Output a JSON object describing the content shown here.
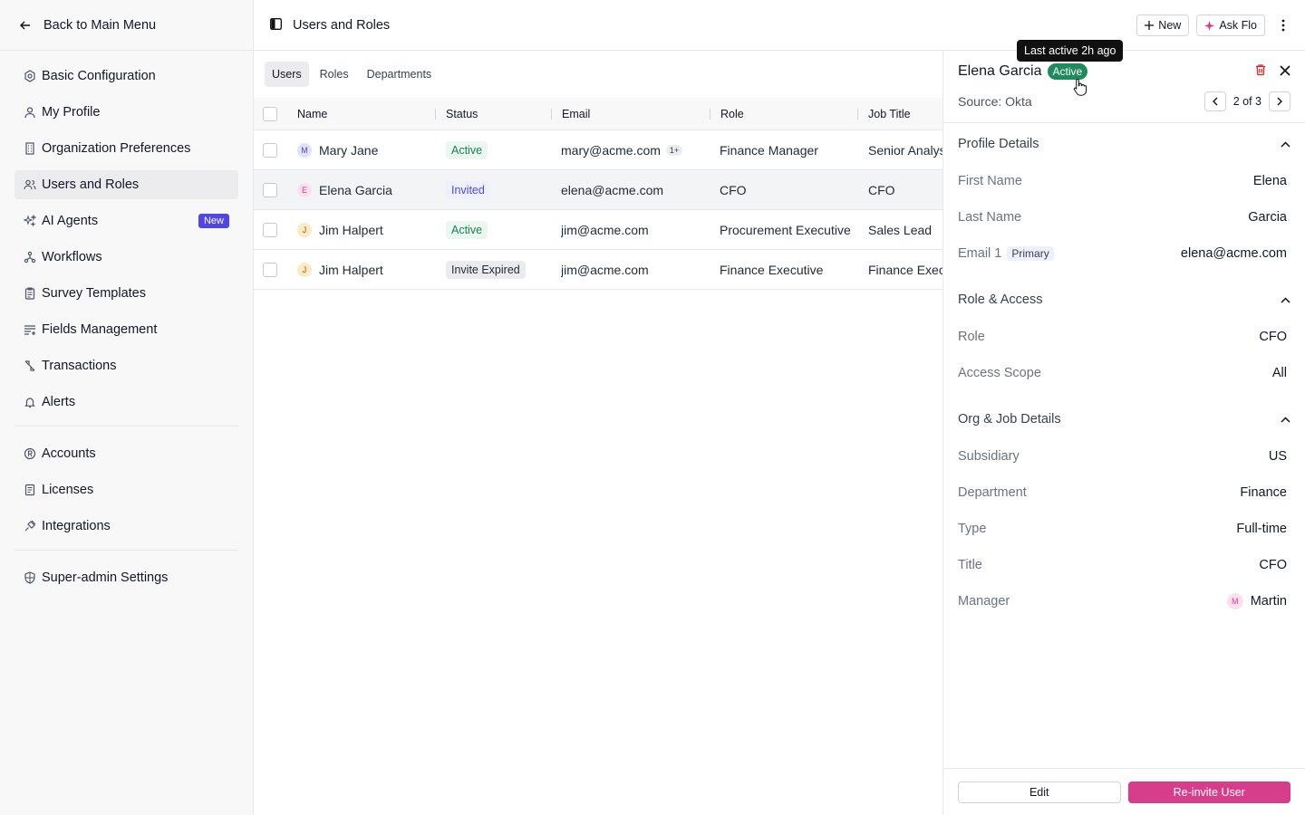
{
  "sidebar": {
    "back_label": "Back to Main Menu",
    "items": [
      {
        "label": "Basic Configuration",
        "icon": "gear-icon"
      },
      {
        "label": "My Profile",
        "icon": "user-icon"
      },
      {
        "label": "Organization Preferences",
        "icon": "building-icon"
      },
      {
        "label": "Users and Roles",
        "icon": "users-icon",
        "active": true
      },
      {
        "label": "AI Agents",
        "icon": "sparkle-icon",
        "badge": "New"
      },
      {
        "label": "Workflows",
        "icon": "workflow-icon"
      },
      {
        "label": "Survey Templates",
        "icon": "clipboard-icon"
      },
      {
        "label": "Fields Management",
        "icon": "list-icon"
      },
      {
        "label": "Transactions",
        "icon": "transaction-icon"
      },
      {
        "label": "Alerts",
        "icon": "bell-icon"
      },
      {
        "label": "Accounts",
        "icon": "accounts-icon"
      },
      {
        "label": "Licenses",
        "icon": "license-icon"
      },
      {
        "label": "Integrations",
        "icon": "plug-icon"
      },
      {
        "label": "Super-admin Settings",
        "icon": "shield-icon"
      }
    ]
  },
  "header": {
    "title": "Users and Roles",
    "new_label": "New",
    "ask_label": "Ask Flo"
  },
  "tabs": [
    "Users",
    "Roles",
    "Departments"
  ],
  "table": {
    "columns": [
      "Name",
      "Status",
      "Email",
      "Role",
      "Job Title"
    ],
    "rows": [
      {
        "initial": "M",
        "name": "Mary Jane",
        "status": "Active",
        "email": "mary@acme.com",
        "extra": "1+",
        "role": "Finance Manager",
        "job": "Senior Analyst"
      },
      {
        "initial": "E",
        "name": "Elena Garcia",
        "status": "Invited",
        "email": "elena@acme.com",
        "extra": "",
        "role": "CFO",
        "job": "CFO"
      },
      {
        "initial": "J",
        "name": "Jim Halpert",
        "status": "Active",
        "email": "jim@acme.com",
        "extra": "",
        "role": "Procurement Executive",
        "job": "Sales Lead"
      },
      {
        "initial": "J",
        "name": "Jim Halpert",
        "status": "Invite Expired",
        "email": "jim@acme.com",
        "extra": "",
        "role": "Finance Executive",
        "job": "Finance Executive"
      }
    ]
  },
  "panel": {
    "name": "Elena Garcia",
    "status": "Active",
    "source": "Source: Okta",
    "pager": "2 of 3",
    "tooltip": "Last active 2h ago",
    "sections": {
      "profile": {
        "title": "Profile Details",
        "first_name_label": "First Name",
        "first_name": "Elena",
        "last_name_label": "Last Name",
        "last_name": "Garcia",
        "email_label": "Email 1",
        "email_tag": "Primary",
        "email": "elena@acme.com"
      },
      "role": {
        "title": "Role & Access",
        "role_label": "Role",
        "role": "CFO",
        "scope_label": "Access Scope",
        "scope": "All"
      },
      "org": {
        "title": "Org & Job Details",
        "subsidiary_label": "Subsidiary",
        "subsidiary": "US",
        "department_label": "Department",
        "department": "Finance",
        "type_label": "Type",
        "type": "Full-time",
        "title_label": "Title",
        "title_val": "CFO",
        "manager_label": "Manager",
        "manager_initial": "M",
        "manager": "Martin"
      }
    },
    "edit_label": "Edit",
    "reinvite_label": "Re-invite User"
  },
  "colors": {
    "accent": "#d63d8a",
    "active_green": "#1f8a5c",
    "new_badge": "#4f46e5"
  }
}
